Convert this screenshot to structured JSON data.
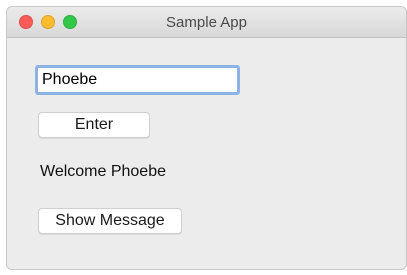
{
  "window": {
    "title": "Sample App",
    "controls": {
      "close_color": "#fc5b57",
      "minimize_color": "#fdbc2e",
      "maximize_color": "#33c748"
    }
  },
  "form": {
    "name_input_value": "Phoebe",
    "enter_button_label": "Enter",
    "welcome_text": "Welcome Phoebe",
    "show_message_button_label": "Show Message"
  },
  "colors": {
    "input_focus_ring": "#8fb2e6",
    "window_background": "#ececec"
  }
}
